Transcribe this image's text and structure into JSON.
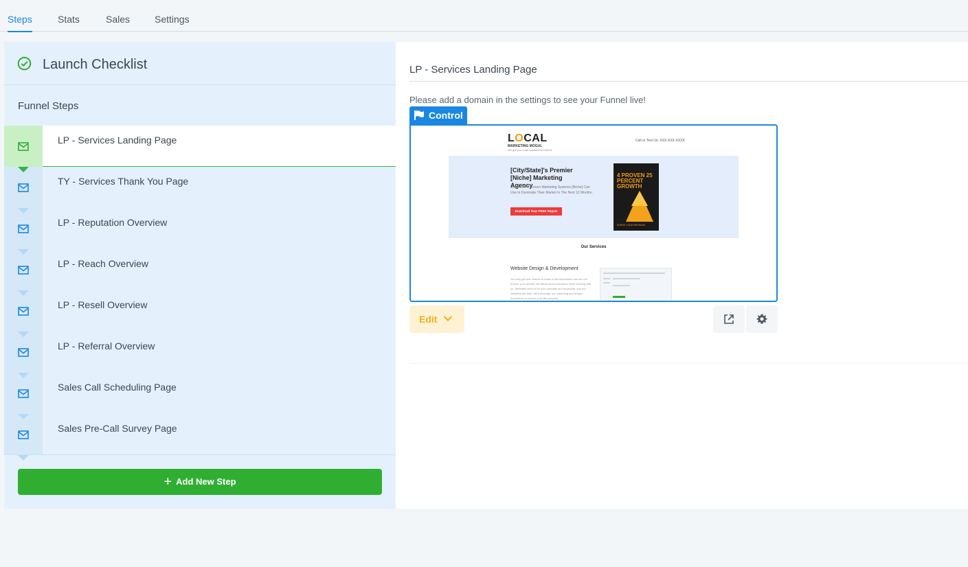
{
  "tabs": [
    {
      "label": "Steps",
      "active": true
    },
    {
      "label": "Stats",
      "active": false
    },
    {
      "label": "Sales",
      "active": false
    },
    {
      "label": "Settings",
      "active": false
    }
  ],
  "sidebar": {
    "checklist_title": "Launch Checklist",
    "funnel_steps_label": "Funnel Steps",
    "steps": [
      {
        "label": "LP - Services Landing Page",
        "icon": "email-icon",
        "active": true
      },
      {
        "label": "TY - Services Thank You Page",
        "icon": "email-icon",
        "active": false
      },
      {
        "label": "LP - Reputation Overview",
        "icon": "email-icon",
        "active": false
      },
      {
        "label": "LP - Reach Overview",
        "icon": "email-icon",
        "active": false
      },
      {
        "label": "LP - Resell Overview",
        "icon": "email-icon",
        "active": false
      },
      {
        "label": "LP - Referral Overview",
        "icon": "email-icon",
        "active": false
      },
      {
        "label": "Sales Call Scheduling Page",
        "icon": "email-icon",
        "active": false
      },
      {
        "label": "Sales Pre-Call Survey Page",
        "icon": "email-icon",
        "active": false
      }
    ],
    "add_step_label": "Add New Step"
  },
  "main": {
    "page_title": "LP - Services Landing Page",
    "domain_message": "Please add a domain in the settings to see your Funnel live!",
    "control_label": "Control",
    "edit_label": "Edit",
    "preview": {
      "logo_text_pre": "L",
      "logo_text_o": "O",
      "logo_text_post": "CAL",
      "logo_sub": "MARKETING MOGUL",
      "logo_tagline": "We get you more customers! Period.",
      "call_text": "Call or Text Us: XXX-XXX-XXXX",
      "hero_title": "[City/State]'s Premier [Niche] Marketing Agency",
      "hero_text": "Learn The 4 Proven Marketing Systems [Niche] Can Use to Dominate Their Market In The Next 12 Months.",
      "cta": "Download Your FREE Report",
      "book_big": "4 PROVEN 25 PERCENT GROWTH",
      "book_small": "SURGE YOUR REVENUE",
      "services_heading": "Our Services",
      "service_title": "Website Design & Development",
      "service_text": "You only get one chance to make a first impression and we can ensure your website will attract local customers when working with us. Websites need to be both beautiful and functional, and our websites are both. We'll leverage our marketing and design experience to ensure your site properly"
    }
  },
  "colors": {
    "accent": "#1c86e0",
    "success": "#2fae32",
    "edit": "#f2b020"
  }
}
